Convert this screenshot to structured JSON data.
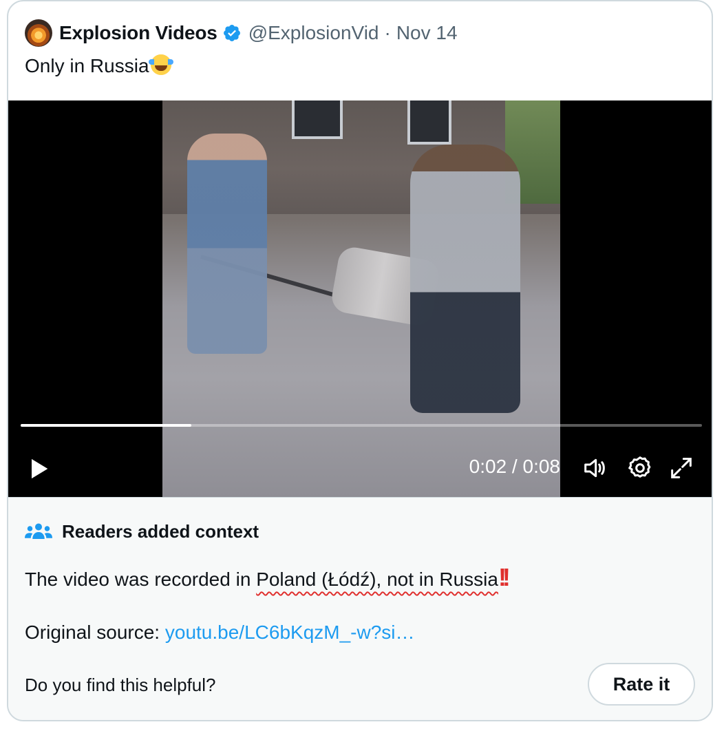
{
  "tweet": {
    "author_name": "Explosion Videos",
    "handle": "@ExplosionVid",
    "separator": "·",
    "date": "Nov 14",
    "text": "Only in Russia",
    "emoji": "face-with-tears-of-joy"
  },
  "video": {
    "time_display": "0:02 / 0:08",
    "progress": 0.25
  },
  "context": {
    "title": "Readers added context",
    "text_before": "The video was recorded in ",
    "text_highlight": "Poland (Łódź), not in Russia",
    "text_bang": "!!",
    "source_label": "Original source: ",
    "source_link": "youtu.be/LC6bKqzM_-w?si…",
    "helpful_question": "Do you find this helpful?",
    "rate_button": "Rate it"
  },
  "colors": {
    "accent": "#1d9bf0",
    "highlight": "#e0302e",
    "text": "#0f1419",
    "secondary": "#536471"
  }
}
